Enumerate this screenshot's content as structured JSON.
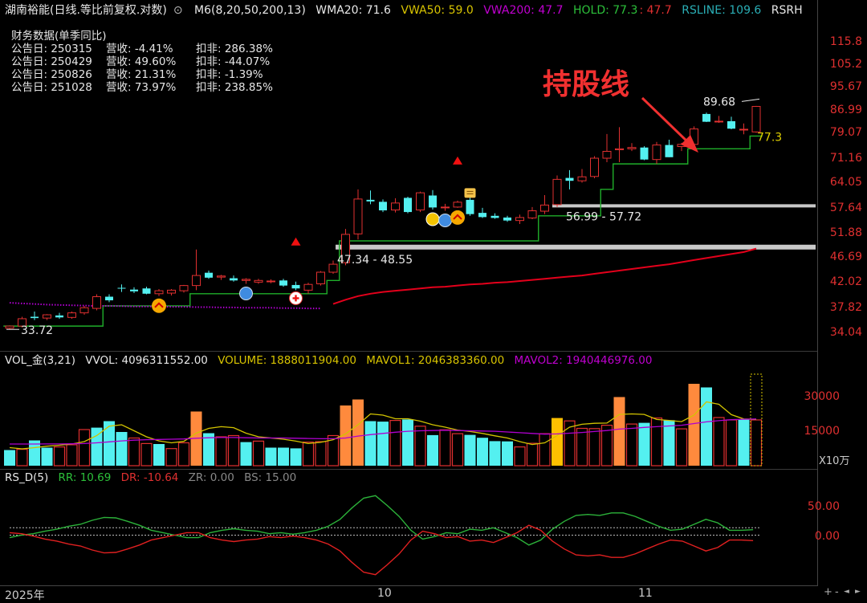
{
  "header": {
    "name": "湖南裕能(日线.等比前复权.对数)",
    "indicator": "M6(8,20,50,200,13)",
    "wma20": "WMA20: 71.6",
    "vwa50": "VWA50: 59.0",
    "vwa200": "VWA200: 47.7",
    "hold": "HOLD: 77.3",
    "hold2": ": 47.7",
    "rsline": "RSLINE: 109.6",
    "rsrh": "RSRH"
  },
  "colors": {
    "up": "#e03030",
    "down": "#54f0f0",
    "hold": "#1fae2a",
    "vwa200": "#e3001b",
    "vwa200_dotted": "#b000d0",
    "mavol1": "#d2c300",
    "mavol2": "#b000d0",
    "vol_orange": "#ff8a3d",
    "vol_gold": "#ffc000",
    "rr": "#2cb23a",
    "dr": "#e02020"
  },
  "fin": {
    "title": "财务数据(单季同比)",
    "rows": [
      {
        "date": "公告日: 250315",
        "rev": "营收: -4.41%",
        "net": "扣非: 286.38%"
      },
      {
        "date": "公告日: 250429",
        "rev": "营收: 49.60%",
        "net": "扣非: -44.07%"
      },
      {
        "date": "公告日: 250826",
        "rev": "营收: 21.31%",
        "net": "扣非: -1.39%"
      },
      {
        "date": "公告日: 251028",
        "rev": "营收: 73.97%",
        "net": "扣非: 238.85%"
      }
    ]
  },
  "annotations": {
    "hold_text": "持股线",
    "low_label": "33.72",
    "high_label": "89.68",
    "hold_value": "77.3",
    "zone1": "47.34 - 48.55",
    "zone2": "56.99 - 57.72"
  },
  "chart_data": [
    {
      "type": "candlestick",
      "title": "",
      "yscale": "log",
      "ylim": [
        31.5,
        125
      ],
      "yticks": [
        "115.8",
        "105.2",
        "95.67",
        "86.99",
        "79.07",
        "71.16",
        "64.05",
        "57.64",
        "51.88",
        "46.69",
        "42.02",
        "37.82",
        "34.04"
      ],
      "candles": [
        [
          33.9,
          34.3,
          33.72,
          34.2
        ],
        [
          34.2,
          35.6,
          34.0,
          35.3
        ],
        [
          35.6,
          36.4,
          35.1,
          35.4
        ],
        [
          35.4,
          36.0,
          35.1,
          35.9
        ],
        [
          35.8,
          36.2,
          35.3,
          35.5
        ],
        [
          35.5,
          36.4,
          35.3,
          36.2
        ],
        [
          36.2,
          37.3,
          35.9,
          37.0
        ],
        [
          36.9,
          39.2,
          36.6,
          38.8
        ],
        [
          38.8,
          39.2,
          37.9,
          38.2
        ],
        [
          40.3,
          40.9,
          39.6,
          40.2
        ],
        [
          40.0,
          40.4,
          39.4,
          39.7
        ],
        [
          40.2,
          40.5,
          39.2,
          39.3
        ],
        [
          39.3,
          40.1,
          38.9,
          39.8
        ],
        [
          39.4,
          40.1,
          39.0,
          39.9
        ],
        [
          39.8,
          40.8,
          39.5,
          40.7
        ],
        [
          40.7,
          47.5,
          39.9,
          42.5
        ],
        [
          43.0,
          43.4,
          41.9,
          42.1
        ],
        [
          42.2,
          42.6,
          41.7,
          42.4
        ],
        [
          42.0,
          42.5,
          41.4,
          41.6
        ],
        [
          41.6,
          42.0,
          41.0,
          41.8
        ],
        [
          41.3,
          41.9,
          41.0,
          41.6
        ],
        [
          41.4,
          41.8,
          41.1,
          41.5
        ],
        [
          41.6,
          41.9,
          40.5,
          40.7
        ],
        [
          40.8,
          41.4,
          39.9,
          40.2
        ],
        [
          39.9,
          41.2,
          39.3,
          40.9
        ],
        [
          41.0,
          43.3,
          40.7,
          43.1
        ],
        [
          43.1,
          45.3,
          42.8,
          44.6
        ],
        [
          44.9,
          51.9,
          44.4,
          50.7
        ],
        [
          50.8,
          61.5,
          49.6,
          59.0
        ],
        [
          58.8,
          61.2,
          57.7,
          58.4
        ],
        [
          58.3,
          58.9,
          55.8,
          56.2
        ],
        [
          56.3,
          59.2,
          55.7,
          58.0
        ],
        [
          59.3,
          59.6,
          55.5,
          55.8
        ],
        [
          56.3,
          60.9,
          55.8,
          60.6
        ],
        [
          59.9,
          61.3,
          56.4,
          56.9
        ],
        [
          56.9,
          57.8,
          56.1,
          57.0
        ],
        [
          57.0,
          58.6,
          56.8,
          58.2
        ],
        [
          58.8,
          59.5,
          54.9,
          55.3
        ],
        [
          55.6,
          56.8,
          54.4,
          54.6
        ],
        [
          54.9,
          55.5,
          54.2,
          54.4
        ],
        [
          54.5,
          54.9,
          53.5,
          53.8
        ],
        [
          53.8,
          55.2,
          53.0,
          54.5
        ],
        [
          54.4,
          57.0,
          54.1,
          56.1
        ],
        [
          56.0,
          60.0,
          55.3,
          57.5
        ],
        [
          57.6,
          65.3,
          57.0,
          64.2
        ],
        [
          64.6,
          66.8,
          61.5,
          63.8
        ],
        [
          63.8,
          67.1,
          63.3,
          64.9
        ],
        [
          65.0,
          70.9,
          64.5,
          70.3
        ],
        [
          70.3,
          78.0,
          69.1,
          72.4
        ],
        [
          72.9,
          80.3,
          69.1,
          73.2
        ],
        [
          73.2,
          75.0,
          72.5,
          73.6
        ],
        [
          73.6,
          74.0,
          69.7,
          69.9
        ],
        [
          69.9,
          75.4,
          68.6,
          74.4
        ],
        [
          74.4,
          76.1,
          70.6,
          70.6
        ],
        [
          73.9,
          75.1,
          72.5,
          74.6
        ],
        [
          74.6,
          80.6,
          73.6,
          79.7
        ],
        [
          85.0,
          85.5,
          82.1,
          82.2
        ],
        [
          82.4,
          84.3,
          81.8,
          82.4
        ],
        [
          82.4,
          84.0,
          79.6,
          79.8
        ],
        [
          79.5,
          81.6,
          77.9,
          79.6
        ],
        [
          78.7,
          88.0,
          78.4,
          87.8
        ]
      ],
      "series": [
        {
          "name": "HOLD",
          "values": [
            34.2,
            34.2,
            34.2,
            34.2,
            34.2,
            34.2,
            34.2,
            34.2,
            37.3,
            37.3,
            37.3,
            37.3,
            37.3,
            37.3,
            37.3,
            39.3,
            39.3,
            39.3,
            39.3,
            39.3,
            39.3,
            39.3,
            39.3,
            39.3,
            39.3,
            39.3,
            41.6,
            49.3,
            49.3,
            49.3,
            49.3,
            49.3,
            49.3,
            49.3,
            49.3,
            49.3,
            49.3,
            49.3,
            49.3,
            49.3,
            49.3,
            49.3,
            49.3,
            54.9,
            54.9,
            54.9,
            54.9,
            54.9,
            61.5,
            68.6,
            68.6,
            68.6,
            68.6,
            68.6,
            68.6,
            73.2,
            73.2,
            73.2,
            73.2,
            73.2,
            77.3
          ]
        },
        {
          "name": "VWA200",
          "values": [
            null,
            null,
            null,
            null,
            null,
            null,
            null,
            null,
            null,
            null,
            null,
            null,
            null,
            null,
            null,
            null,
            null,
            null,
            null,
            null,
            null,
            null,
            null,
            null,
            null,
            null,
            37.6,
            38.3,
            38.9,
            39.3,
            39.6,
            39.8,
            40.0,
            40.2,
            40.4,
            40.5,
            40.7,
            40.9,
            41.0,
            41.2,
            41.3,
            41.5,
            41.7,
            41.9,
            42.1,
            42.3,
            42.5,
            42.8,
            43.1,
            43.4,
            43.7,
            44.0,
            44.3,
            44.6,
            45.0,
            45.4,
            45.8,
            46.2,
            46.6,
            47.0,
            47.7
          ]
        },
        {
          "name": "VWA200_dotted",
          "values": [
            37.8,
            37.7,
            37.6,
            37.5,
            37.45,
            37.4,
            37.35,
            37.3,
            37.3,
            37.25,
            37.2,
            37.2,
            37.2,
            37.15,
            37.15,
            37.1,
            37.1,
            37.05,
            37.05,
            37.0,
            37.0,
            37.0,
            36.95,
            36.95,
            36.9,
            36.9
          ]
        }
      ],
      "zones": [
        {
          "value": 57.3,
          "label": "56.99 - 57.72"
        },
        {
          "value": 48.0,
          "label": "47.34 - 48.55"
        }
      ],
      "markers": [
        {
          "i": 12,
          "kind": "up-arrow"
        },
        {
          "i": 19,
          "kind": "blue-ball"
        },
        {
          "i": 23,
          "kind": "red-triangle"
        },
        {
          "i": 23,
          "kind": "plus"
        },
        {
          "i": 34,
          "kind": "money"
        },
        {
          "i": 35,
          "kind": "blue-ball"
        },
        {
          "i": 36,
          "kind": "up-arrow"
        },
        {
          "i": 36,
          "kind": "red-triangle"
        },
        {
          "i": 37,
          "kind": "clipboard"
        }
      ]
    },
    {
      "type": "bar",
      "title": "VOL_金(3,21)",
      "readouts": {
        "vvol": "VVOL: 4096311552.00",
        "volume": "VOLUME: 1888011904.00",
        "mavol1": "MAVOL1: 2046383360.00",
        "mavol2": "MAVOL2: 1940446976.00"
      },
      "unit": "X10万",
      "ylim": [
        0,
        40000
      ],
      "yticks": [
        "30000",
        "15000"
      ],
      "values": [
        6500,
        6800,
        10500,
        7500,
        7800,
        8700,
        15000,
        15800,
        18500,
        14000,
        11500,
        9200,
        9000,
        7100,
        9500,
        22500,
        13500,
        12000,
        12500,
        9800,
        10200,
        7500,
        7500,
        7200,
        9800,
        10000,
        12500,
        25000,
        27500,
        18500,
        18300,
        18800,
        19200,
        16400,
        12700,
        14900,
        13300,
        12800,
        11600,
        10200,
        10100,
        7800,
        9300,
        13300,
        19800,
        18600,
        15500,
        15400,
        16800,
        28500,
        17300,
        17800,
        19800,
        18900,
        15300,
        34000,
        32500,
        20000,
        19000,
        19200,
        19000
      ],
      "bar_style": [
        "down",
        "up",
        "down",
        "down",
        "up",
        "up",
        "up",
        "down",
        "down",
        "down",
        "up",
        "up",
        "down",
        "up",
        "up",
        "orange",
        "down",
        "up",
        "up",
        "down",
        "up",
        "down",
        "down",
        "down",
        "up",
        "up",
        "up",
        "orange",
        "orange",
        "down",
        "down",
        "up",
        "down",
        "up",
        "down",
        "up",
        "up",
        "down",
        "down",
        "down",
        "down",
        "up",
        "up",
        "up",
        "gold",
        "up",
        "up",
        "up",
        "up",
        "orange",
        "up",
        "down",
        "up",
        "down",
        "up",
        "orange",
        "down",
        "up",
        "up",
        "down",
        "up"
      ],
      "series": [
        {
          "name": "MAVOL1",
          "values": [
            7500,
            7000,
            7500,
            8100,
            8500,
            9000,
            10000,
            12500,
            16400,
            17000,
            14500,
            12000,
            10300,
            9500,
            10100,
            13500,
            15500,
            16200,
            15800,
            13500,
            12000,
            11500,
            11000,
            10200,
            9200,
            9700,
            10800,
            13200,
            17000,
            21500,
            21000,
            19500,
            19500,
            18500,
            17000,
            16000,
            14800,
            14200,
            13400,
            12400,
            11500,
            10000,
            8800,
            9500,
            12500,
            16000,
            17200,
            17600,
            17700,
            21300,
            21500,
            21300,
            19200,
            18800,
            18300,
            21000,
            26500,
            25500,
            21200,
            19400,
            19200
          ]
        },
        {
          "name": "MAVOL2",
          "values": [
            9000,
            9000,
            9000,
            9050,
            9050,
            9100,
            9200,
            9500,
            9900,
            10300,
            10600,
            10800,
            10900,
            11000,
            11100,
            11400,
            11600,
            11700,
            11700,
            11600,
            11500,
            11500,
            11500,
            11400,
            11300,
            11200,
            11200,
            11500,
            12300,
            12900,
            13400,
            13900,
            14300,
            14500,
            14600,
            14700,
            14600,
            14500,
            14400,
            14300,
            14000,
            13700,
            13400,
            13100,
            13200,
            13500,
            13800,
            14200,
            14600,
            15200,
            15500,
            15900,
            16200,
            16500,
            16800,
            17500,
            18200,
            18700,
            19100,
            19300,
            19400
          ]
        }
      ]
    },
    {
      "type": "line",
      "title": "RS_D(5)",
      "readouts": {
        "rr": "RR: 10.69",
        "dr": "DR: -10.64",
        "zr": "ZR: 0.00",
        "bs": "BS: 15.00"
      },
      "ylim": [
        -100,
        100
      ],
      "yticks": [
        "50.00",
        "0.00"
      ],
      "series": [
        {
          "name": "RR",
          "values": [
            -5,
            0,
            3,
            8,
            12,
            18,
            22,
            30,
            36,
            35,
            28,
            20,
            10,
            5,
            0,
            -5,
            -5,
            5,
            10,
            13,
            10,
            8,
            3,
            5,
            2,
            5,
            10,
            18,
            32,
            55,
            75,
            80,
            60,
            38,
            10,
            -8,
            -3,
            5,
            3,
            12,
            10,
            15,
            5,
            -5,
            -20,
            -10,
            12,
            28,
            40,
            42,
            40,
            45,
            45,
            38,
            28,
            18,
            10,
            12,
            22,
            32,
            25,
            10,
            10,
            11
          ]
        },
        {
          "name": "DR",
          "values": [
            5,
            3,
            -2,
            -8,
            -12,
            -18,
            -22,
            -30,
            -36,
            -35,
            -28,
            -20,
            -10,
            -5,
            0,
            5,
            5,
            -5,
            -10,
            -13,
            -10,
            -8,
            -3,
            -5,
            -2,
            -5,
            -10,
            -18,
            -32,
            -55,
            -75,
            -80,
            -60,
            -38,
            -10,
            8,
            3,
            -5,
            -3,
            -12,
            -10,
            -15,
            -5,
            5,
            20,
            10,
            -12,
            -28,
            -40,
            -42,
            -40,
            -45,
            -45,
            -38,
            -28,
            -18,
            -10,
            -12,
            -22,
            -32,
            -25,
            -10,
            -10,
            -11
          ]
        }
      ]
    }
  ],
  "x_labels": {
    "year": "2025年",
    "oct": "10",
    "nov": "11"
  },
  "controls": {
    "plus": "+",
    "minus": "-",
    "left": "◄",
    "right": "►"
  }
}
